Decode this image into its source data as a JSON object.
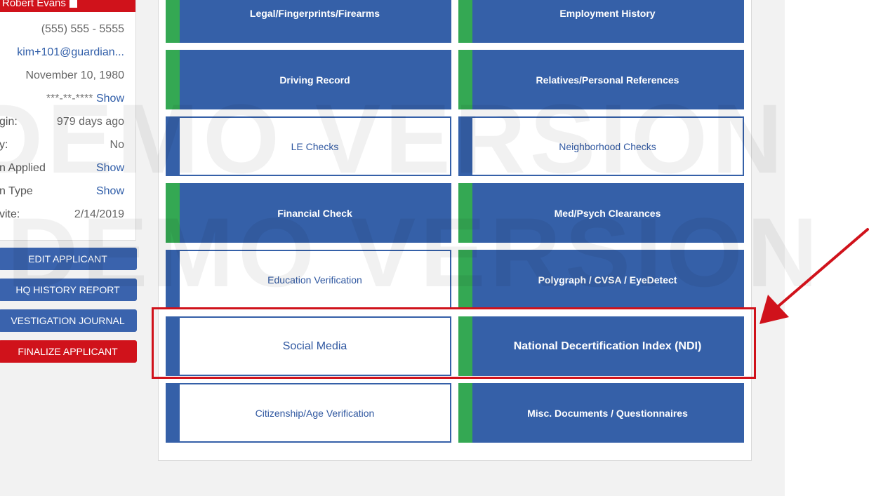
{
  "applicant": {
    "name": "Robert Evans",
    "phone": "(555) 555 - 5555",
    "email": "kim+101@guardian...",
    "dob": "November 10, 1980",
    "ssn_mask": "***-**-****",
    "ssn_show": "Show",
    "last_login_label": "gin:",
    "last_login_value": "979 days ago",
    "row7_label": "y:",
    "row7_value": "No",
    "position_applied_label": "n Applied",
    "position_applied_value": "Show",
    "position_type_label": "n Type",
    "position_type_value": "Show",
    "invite_label": "vite:",
    "invite_value": "2/14/2019"
  },
  "side_buttons": {
    "edit": "EDIT APPLICANT",
    "history": "HQ HISTORY REPORT",
    "journal": "VESTIGATION JOURNAL",
    "finalize": "FINALIZE APPLICANT"
  },
  "tiles": {
    "legal": "Legal/Fingerprints/Firearms",
    "employment": "Employment History",
    "driving": "Driving Record",
    "relatives": "Relatives/Personal References",
    "le_checks": "LE Checks",
    "neighborhood": "Neighborhood Checks",
    "financial": "Financial Check",
    "med_psych": "Med/Psych Clearances",
    "education": "Education Verification",
    "polygraph": "Polygraph / CVSA / EyeDetect",
    "social_media": "Social Media",
    "ndi": "National Decertification Index (NDI)",
    "citizenship": "Citizenship/Age Verification",
    "misc": "Misc. Documents / Questionnaires"
  },
  "watermark": "DEMO VERSION",
  "colors": {
    "tile_blue": "#3560a8",
    "complete_green": "#34a853",
    "annotation_red": "#d0121b"
  }
}
